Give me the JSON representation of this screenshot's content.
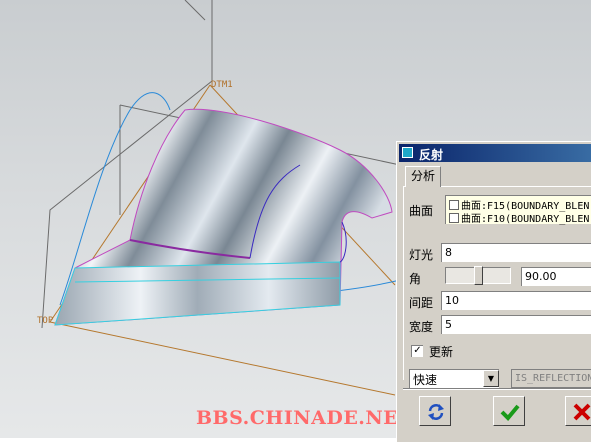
{
  "viewport": {
    "datum_labels": [
      "DTM1",
      "TOP"
    ],
    "watermark": "BBS.CHINADE.NET"
  },
  "dialog": {
    "title": "反射",
    "tab": "分析",
    "surface_label": "曲面",
    "surfaces": [
      "曲面:F15(BOUNDARY_BLEN",
      "曲面:F10(BOUNDARY_BLEN"
    ],
    "light_label": "灯光",
    "light_value": "8",
    "angle_label": "角",
    "angle_value": "90.00",
    "angle_slider_fraction": 0.5,
    "spacing_label": "间距",
    "spacing_value": "10",
    "width_label": "宽度",
    "width_value": "5",
    "update_label": "更新",
    "update_checked": true,
    "speed_option": "快速",
    "result_name": "IS_REFLECTION",
    "buttons": {
      "repeat_icon": "refresh-arrows-icon",
      "ok_icon": "checkmark-icon",
      "cancel_icon": "close-x-icon"
    },
    "colors": {
      "titlebar": "#0a246a",
      "ok_green": "#1a9a1a",
      "cancel_red": "#cc0000",
      "repeat_blue": "#2050c0"
    }
  }
}
